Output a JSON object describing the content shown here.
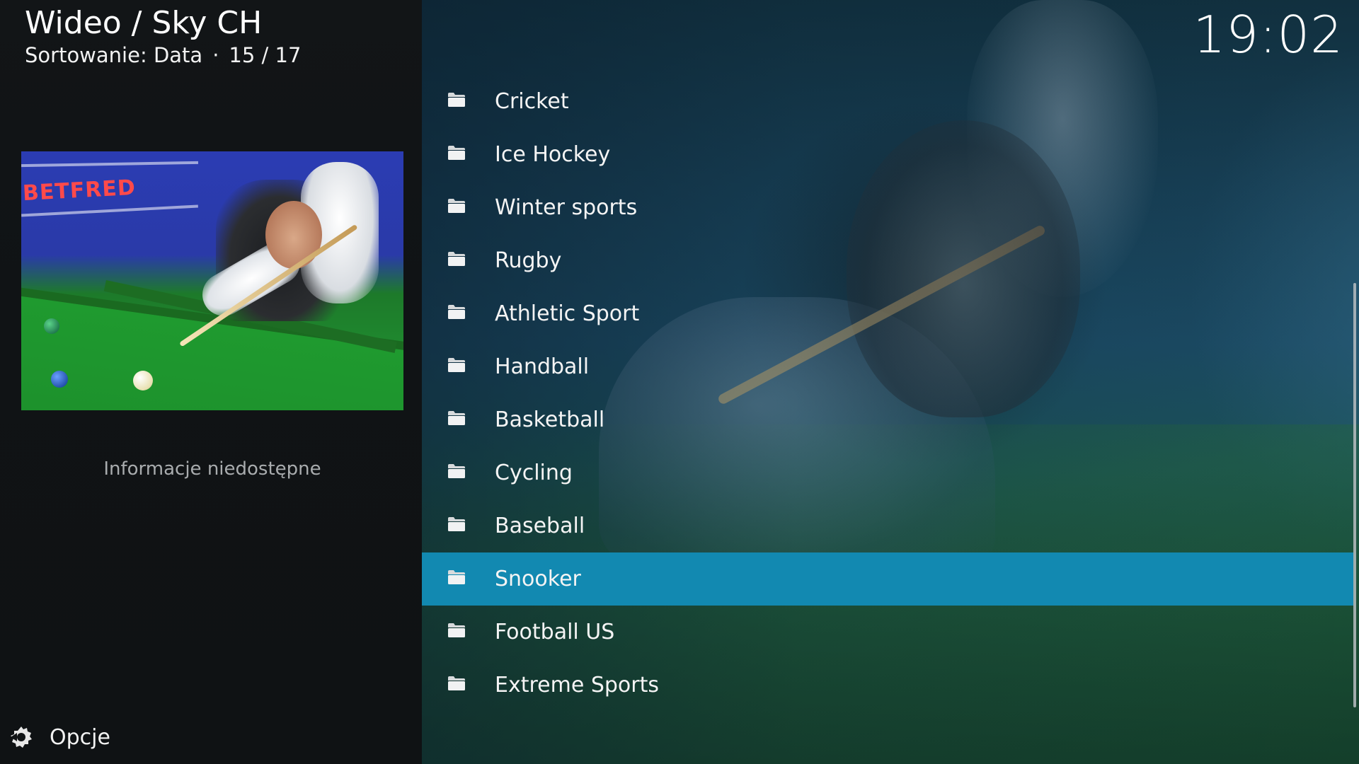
{
  "header": {
    "path": "Wideo / Sky CH",
    "sort_label": "Sortowanie: Data",
    "separator": "·",
    "position": "15 / 17"
  },
  "clock": "19:02",
  "thumbnail": {
    "banner_text": "BETFRED"
  },
  "info": {
    "text": "Informacje niedostępne"
  },
  "options": {
    "label": "Opcje",
    "icon": "options-gear-icon"
  },
  "list": {
    "items": [
      {
        "label": "Cricket",
        "icon": "folder-icon"
      },
      {
        "label": "Ice Hockey",
        "icon": "folder-icon"
      },
      {
        "label": "Winter sports",
        "icon": "folder-icon"
      },
      {
        "label": "Rugby",
        "icon": "folder-icon"
      },
      {
        "label": "Athletic Sport",
        "icon": "folder-icon"
      },
      {
        "label": "Handball",
        "icon": "folder-icon"
      },
      {
        "label": "Basketball",
        "icon": "folder-icon"
      },
      {
        "label": "Cycling",
        "icon": "folder-icon"
      },
      {
        "label": "Baseball",
        "icon": "folder-icon"
      },
      {
        "label": "Snooker",
        "icon": "folder-icon"
      },
      {
        "label": "Football US",
        "icon": "folder-icon"
      },
      {
        "label": "Extreme Sports",
        "icon": "folder-icon"
      }
    ],
    "selected_label": "Snooker"
  },
  "colors": {
    "selection": "#1289b1",
    "panel": "#111416",
    "text": "#f4f4f4",
    "muted_text": "#a9acae"
  }
}
